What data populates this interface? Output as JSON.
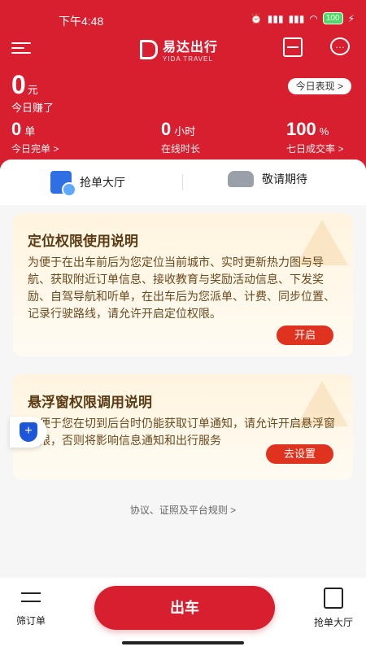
{
  "status_bar": {
    "time": "下午4:48",
    "battery": "100"
  },
  "topbar": {
    "brand_cn": "易达出行",
    "brand_en": "YIDA TRAVEL"
  },
  "earnings": {
    "amount": "0",
    "unit": "元",
    "label": "今日赚了",
    "today_performance": "今日表现 >"
  },
  "stats": [
    {
      "value": "0",
      "unit": "单",
      "label": "今日完单 >"
    },
    {
      "value": "0",
      "unit": "小时",
      "label": "在线时长"
    },
    {
      "value": "100",
      "unit": "%",
      "label": "七日成交率 >"
    }
  ],
  "tabs": {
    "grab": "抢单大厅",
    "wait": "敬请期待"
  },
  "cards": [
    {
      "title": "定位权限使用说明",
      "body": "为便于在出车前后为您定位当前城市、实时更新热力图与导航、获取附近订单信息、接收教育与奖励活动信息、下发奖励、自驾导航和听单，在出车后为您派单、计费、同步位置、记录行驶路线，请允许开启定位权限。",
      "button": "开启"
    },
    {
      "title": "悬浮窗权限调用说明",
      "body": "为便于您在切到后台时仍能获取订单通知，请允许开启悬浮窗权限，否则将影响信息通知和出行服务",
      "button": "去设置"
    }
  ],
  "rules_link": "协议、证照及平台规则 >",
  "bottombar": {
    "filter": "筛订单",
    "go": "出车",
    "grab": "抢单大厅"
  }
}
